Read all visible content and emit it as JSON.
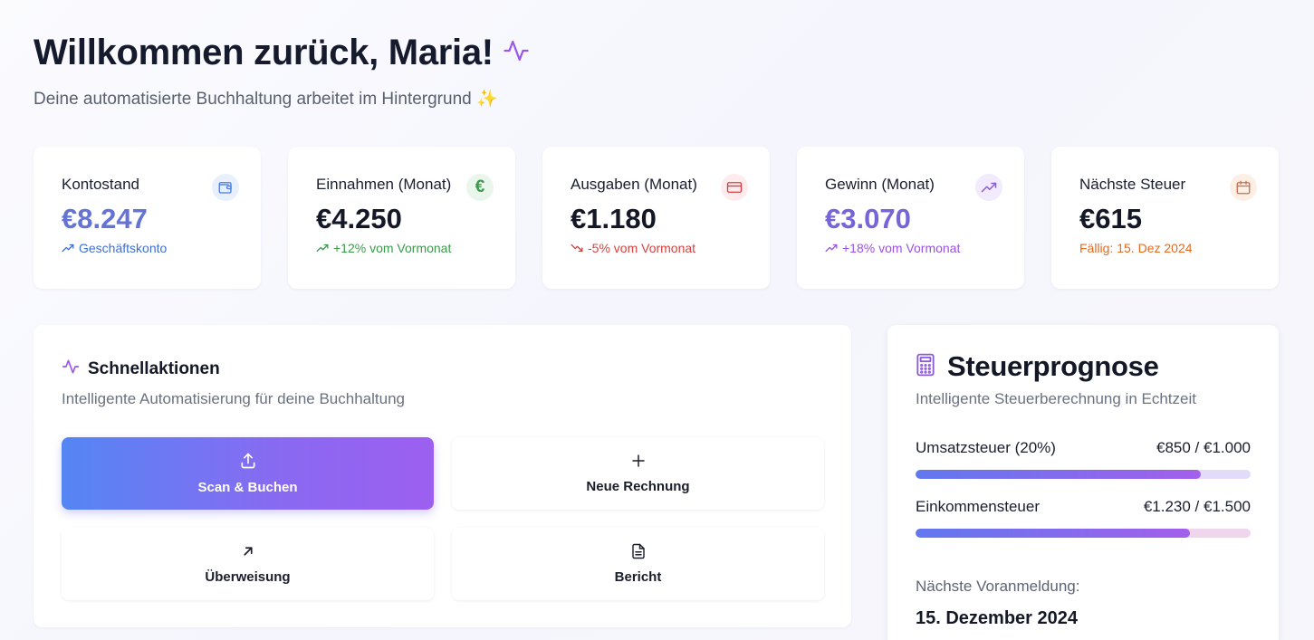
{
  "header": {
    "title": "Willkommen zurück, Maria!",
    "subtitle": "Deine automatisierte Buchhaltung arbeitet im Hintergrund",
    "subtitle_icon": "sparkles-icon",
    "title_icon": "activity-icon"
  },
  "stats": [
    {
      "label": "Kontostand",
      "value": "€8.247",
      "sub": "Geschäftskonto",
      "icon": "wallet-icon",
      "sub_color": "#3b6fd6",
      "sub_icon": "trend-up-icon"
    },
    {
      "label": "Einnahmen (Monat)",
      "value": "€4.250",
      "sub": "+12% vom Vormonat",
      "icon": "euro-icon",
      "sub_color": "#3a9a4b",
      "sub_icon": "trend-up-icon"
    },
    {
      "label": "Ausgaben (Monat)",
      "value": "€1.180",
      "sub": "-5% vom Vormonat",
      "icon": "credit-card-icon",
      "sub_color": "#d6413f",
      "sub_icon": "trend-down-icon"
    },
    {
      "label": "Gewinn (Monat)",
      "value": "€3.070",
      "sub": "+18% vom Vormonat",
      "icon": "trend-up-icon",
      "sub_color": "#9b52e3",
      "sub_icon": "trend-up-icon"
    },
    {
      "label": "Nächste Steuer",
      "value": "€615",
      "sub": "Fällig: 15. Dez 2024",
      "icon": "calendar-icon",
      "sub_color": "#e46a1f",
      "sub_icon": ""
    }
  ],
  "quick_actions": {
    "title": "Schnellaktionen",
    "subtitle": "Intelligente Automatisierung für deine Buchhaltung",
    "actions": [
      {
        "label": "Scan & Buchen",
        "icon": "upload-icon"
      },
      {
        "label": "Neue Rechnung",
        "icon": "plus-icon"
      },
      {
        "label": "Überweisung",
        "icon": "arrow-up-right-icon"
      },
      {
        "label": "Bericht",
        "icon": "file-text-icon"
      }
    ]
  },
  "tax_forecast": {
    "title": "Steuerprognose",
    "subtitle": "Intelligente Steuerberechnung in Echtzeit",
    "icon": "calculator-icon",
    "rows": [
      {
        "label": "Umsatzsteuer (20%)",
        "amount": "€850 / €1.000",
        "fraction": 0.85
      },
      {
        "label": "Einkommensteuer",
        "amount": "€1.230 / €1.500",
        "fraction": 0.82
      }
    ],
    "next_label": "Nächste Voranmeldung:",
    "next_date": "15. Dezember 2024"
  },
  "colors": {
    "accent_blue": "#6574d4",
    "accent_violet": "#8a69f1",
    "positive": "#3a9a4b",
    "negative": "#d6413f",
    "warning": "#e46a1f"
  }
}
